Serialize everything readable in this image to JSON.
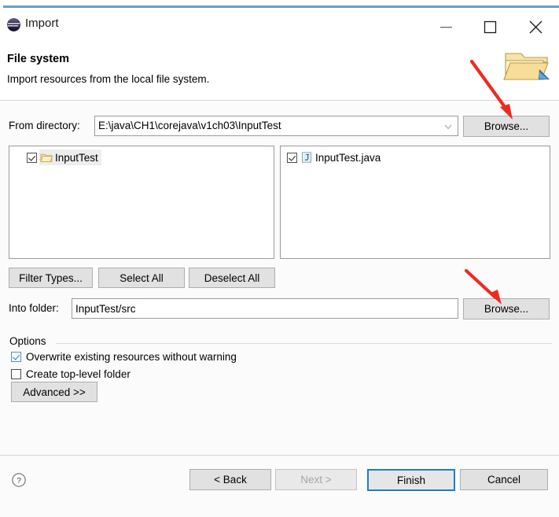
{
  "window": {
    "title": "Import",
    "app_icon": "eclipse-icon",
    "controls": {
      "minimize": "minimize-icon",
      "maximize": "maximize-icon",
      "close": "close-icon"
    }
  },
  "banner": {
    "title": "File system",
    "description": "Import resources from the local file system.",
    "icon": "open-folder-import-icon"
  },
  "from_directory": {
    "label": "From directory:",
    "value": "E:\\java\\CH1\\corejava\\v1ch03\\InputTest",
    "placeholder": "",
    "dropdown_icon": "chevron-down-icon",
    "browse_label": "Browse..."
  },
  "trees": {
    "left": {
      "items": [
        {
          "label": "InputTest",
          "checked": true,
          "selected": true,
          "icon": "folder-icon"
        }
      ]
    },
    "right": {
      "items": [
        {
          "label": "InputTest.java",
          "checked": true,
          "selected": false,
          "icon": "java-file-icon"
        }
      ]
    }
  },
  "selection_buttons": {
    "filter_types": "Filter Types...",
    "select_all": "Select All",
    "deselect_all": "Deselect All"
  },
  "into_folder": {
    "label": "Into folder:",
    "value": "InputTest/src",
    "placeholder": "",
    "browse_label": "Browse..."
  },
  "options": {
    "legend": "Options",
    "items": [
      {
        "label": "Overwrite existing resources without warning",
        "checked": true
      },
      {
        "label": "Create top-level folder",
        "checked": false
      }
    ],
    "advanced_label": "Advanced >>"
  },
  "footer": {
    "help_icon": "help-icon",
    "back_label": "< Back",
    "next_label": "Next >",
    "next_disabled": true,
    "finish_label": "Finish",
    "finish_default": true,
    "cancel_label": "Cancel"
  },
  "annotations": {
    "arrow_color": "#ee2b22",
    "arrows": [
      {
        "name": "arrow-to-browse-directory",
        "target": "browse-directory-button"
      },
      {
        "name": "arrow-to-browse-folder",
        "target": "browse-folder-button"
      }
    ]
  },
  "colors": {
    "accent": "#6b9dc6",
    "default_button_border": "#1f7dd0",
    "checkbox_blue": "#4a8fd1",
    "arrow_red": "#ee2b22"
  }
}
